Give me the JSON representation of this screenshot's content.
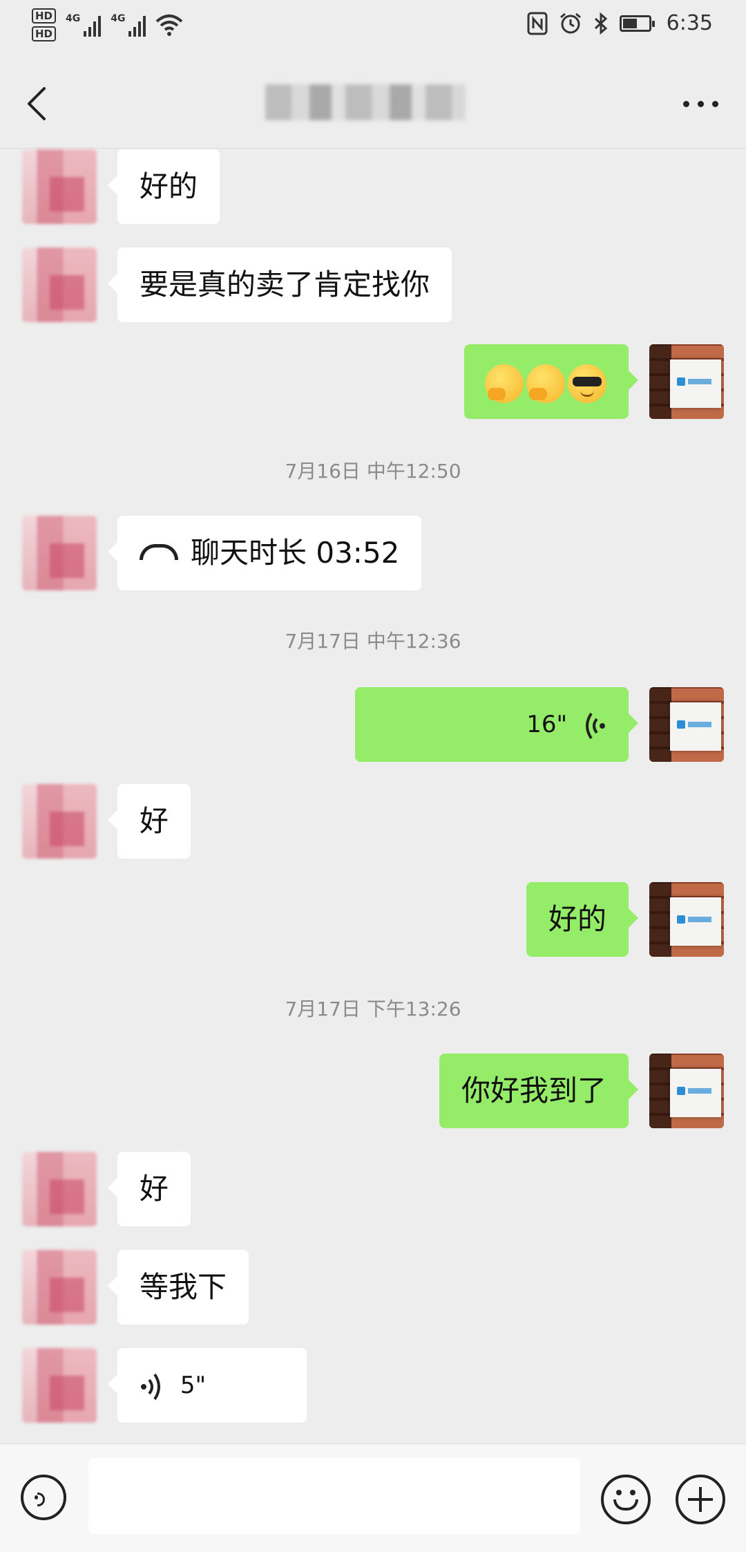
{
  "status_bar": {
    "hd1": "HD",
    "hd2": "HD",
    "net1": "4G",
    "net2": "4G",
    "time": "6:35",
    "battery_level": 0.55
  },
  "nav": {
    "title": ""
  },
  "messages": [
    {
      "side": "left",
      "text": "好的"
    },
    {
      "side": "left",
      "text": "要是真的卖了肯定找你"
    },
    {
      "side": "right",
      "emojis": [
        "thinking-face-icon",
        "thinking-face-icon",
        "cool-face-icon"
      ]
    },
    {
      "timestamp": "7月16日 中午12:50"
    },
    {
      "side": "left",
      "type": "call",
      "text": "聊天时长 03:52"
    },
    {
      "timestamp": "7月17日 中午12:36"
    },
    {
      "side": "right",
      "type": "voice",
      "text": "16\""
    },
    {
      "side": "left",
      "text": "好"
    },
    {
      "side": "right",
      "text": "好的"
    },
    {
      "timestamp": "7月17日 下午13:26"
    },
    {
      "side": "right",
      "text": "你好我到了"
    },
    {
      "side": "left",
      "text": "好"
    },
    {
      "side": "left",
      "text": "等我下"
    },
    {
      "side": "left",
      "type": "voice",
      "text": "5\""
    }
  ],
  "input": {
    "value": ""
  },
  "colors": {
    "accent_bubble": "#95ec69",
    "background": "#ededed"
  }
}
